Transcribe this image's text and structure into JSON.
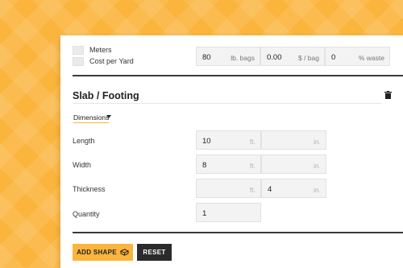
{
  "options": {
    "meters_label": "Meters",
    "cost_label": "Cost per Yard"
  },
  "bag_settings": {
    "bag_weight_value": "80",
    "bag_weight_unit": "lb. bags",
    "cost_value": "0.00",
    "cost_unit": "$ / bag",
    "waste_value": "0",
    "waste_unit": "% waste"
  },
  "shape": {
    "title": "Slab / Footing",
    "dimensions_label": "Dimensions",
    "rows": [
      {
        "label": "Length",
        "ft_value": "10",
        "ft_unit": "ft.",
        "in_value": "",
        "in_unit": "in."
      },
      {
        "label": "Width",
        "ft_value": "8",
        "ft_unit": "ft.",
        "in_value": "",
        "in_unit": "in."
      },
      {
        "label": "Thickness",
        "ft_value": "",
        "ft_unit": "ft.",
        "in_value": "4",
        "in_unit": "in."
      }
    ],
    "quantity_label": "Quantity",
    "quantity_value": "1"
  },
  "actions": {
    "add_shape_label": "ADD SHAPE",
    "reset_label": "RESET"
  },
  "colors": {
    "accent": "#fbb43c",
    "dark": "#2b2b2b"
  }
}
